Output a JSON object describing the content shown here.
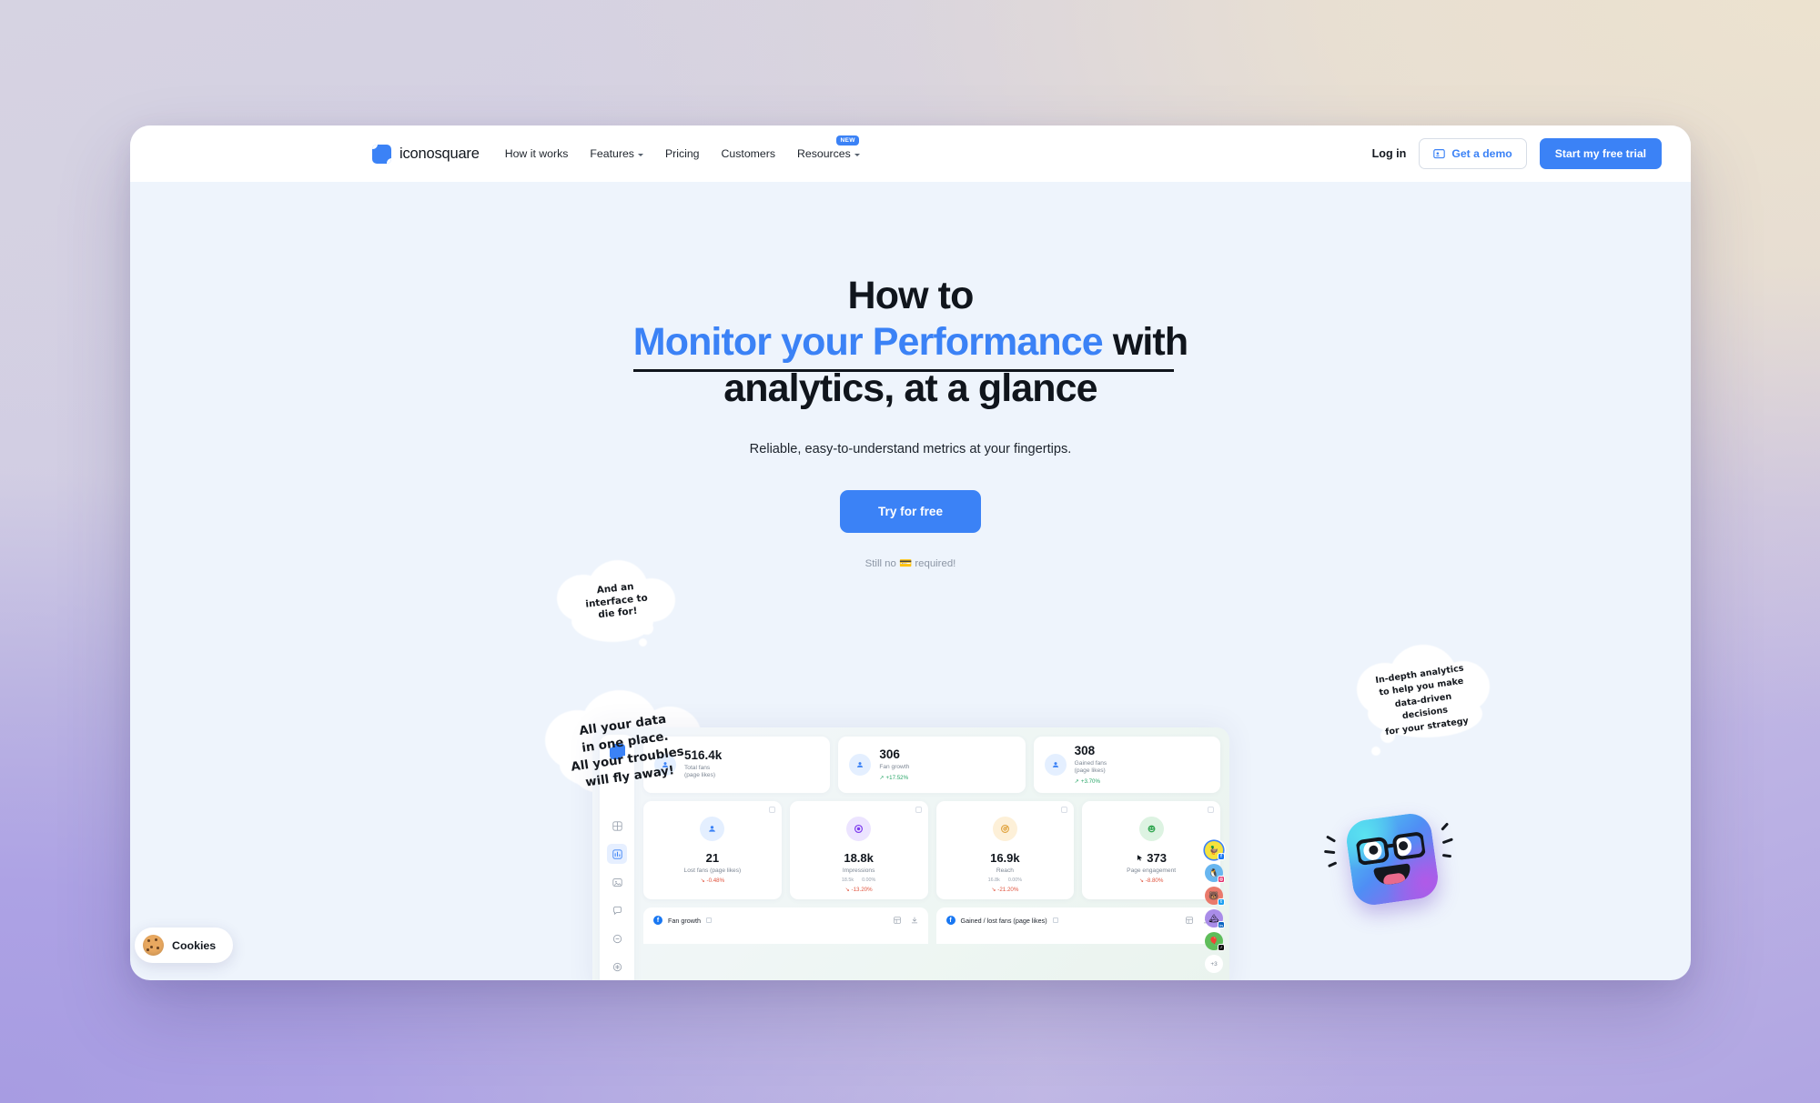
{
  "header": {
    "brand": "iconosquare",
    "nav": [
      {
        "label": "How it works",
        "caret": false,
        "badge": null
      },
      {
        "label": "Features",
        "caret": true,
        "badge": null
      },
      {
        "label": "Pricing",
        "caret": false,
        "badge": null
      },
      {
        "label": "Customers",
        "caret": false,
        "badge": null
      },
      {
        "label": "Resources",
        "caret": true,
        "badge": "NEW"
      }
    ],
    "login": "Log in",
    "demo": "Get a demo",
    "trial": "Start my free trial"
  },
  "hero": {
    "line1": "How to",
    "accent": "Monitor your Performance",
    "line2_tail": "with",
    "line3": "analytics, at a glance",
    "subtitle": "Reliable, easy-to-understand metrics at your fingertips.",
    "cta": "Try for free",
    "nocard": "Still no 💳 required!"
  },
  "bubbles": {
    "b1": "And an\ninterface to\ndie for!",
    "b2": "All your data\nin one place.\nAll your troubles\nwill fly away!",
    "b3": "In-depth analytics\nto help you make\ndata-driven decisions\nfor your strategy"
  },
  "dashboard": {
    "sidebar_icons": [
      "grid-icon",
      "chart-icon",
      "image-icon",
      "comment-icon",
      "minus-circle-icon",
      "scale-icon"
    ],
    "kpis": [
      {
        "value": "516.4k",
        "label": "Total fans\n(page likes)",
        "delta": null,
        "dir": null
      },
      {
        "value": "306",
        "label": "Fan growth",
        "delta": "+17.52%",
        "dir": "up"
      },
      {
        "value": "308",
        "label": "Gained fans\n(page likes)",
        "delta": "+3.70%",
        "dir": "up"
      }
    ],
    "cards": [
      {
        "value": "21",
        "label": "Lost fans (page likes)",
        "delta": "-0.48%",
        "dir": "down",
        "icon": "people-icon",
        "tint": "#e4efff",
        "sub": []
      },
      {
        "value": "18.8k",
        "label": "Impressions",
        "delta": "-13.20%",
        "dir": "down",
        "icon": "eye-icon",
        "tint": "#ece4ff",
        "sub": [
          "18.5k",
          "0.00%"
        ]
      },
      {
        "value": "16.9k",
        "label": "Reach",
        "delta": "-21.20%",
        "dir": "down",
        "icon": "target-icon",
        "tint": "#fdf0d8",
        "sub": [
          "16.8k",
          "0.00%"
        ]
      },
      {
        "value": "373",
        "label": "Page engagement",
        "delta": "-8.80%",
        "dir": "down",
        "icon": "smile-icon",
        "tint": "#ddf3e2",
        "sub": []
      }
    ],
    "charts": [
      {
        "title": "Fan growth",
        "network": "f"
      },
      {
        "title": "Gained / lost fans (page likes)",
        "network": "f"
      }
    ],
    "accounts": [
      {
        "tint": "#f5e23c",
        "badge": "f",
        "badge_color": "#1877f2",
        "selected": true
      },
      {
        "tint": "#68b6f0",
        "badge": "◎",
        "badge_color": "#e1306c",
        "selected": false
      },
      {
        "tint": "#ea7a6b",
        "badge": "t",
        "badge_color": "#1da1f2",
        "selected": false
      },
      {
        "tint": "#a98ce8",
        "badge": "in",
        "badge_color": "#0a66c2",
        "selected": false
      },
      {
        "tint": "#5fbd5a",
        "badge": "♪",
        "badge_color": "#111111",
        "selected": false
      }
    ],
    "more_accounts": "+3",
    "add_account": "+"
  },
  "cookies": {
    "label": "Cookies"
  },
  "colors": {
    "accent": "#3b82f6",
    "up": "#27a567",
    "down": "#e0523c"
  }
}
